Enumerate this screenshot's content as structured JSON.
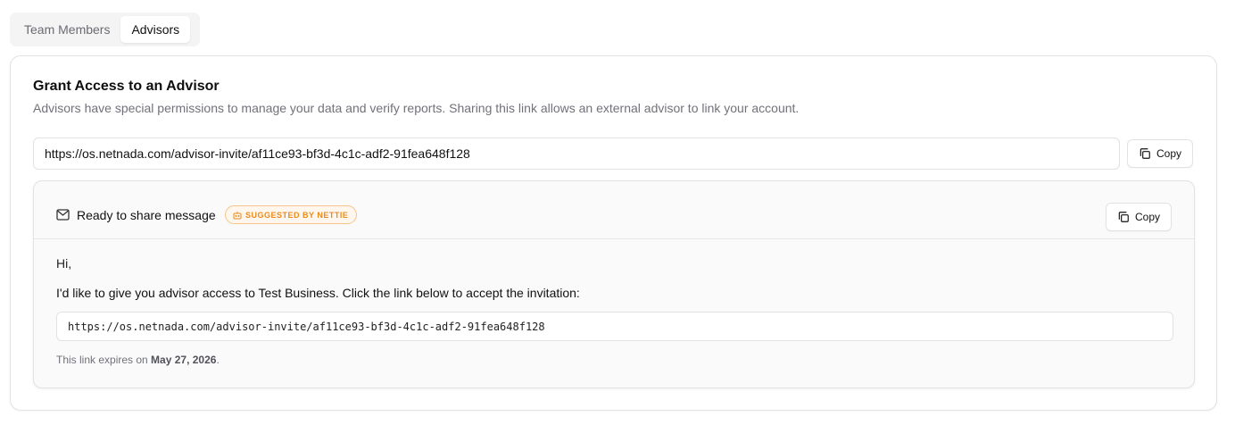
{
  "tabs": [
    {
      "label": "Team Members",
      "active": false
    },
    {
      "label": "Advisors",
      "active": true
    }
  ],
  "card": {
    "title": "Grant Access to an Advisor",
    "description": "Advisors have special permissions to manage your data and verify reports. Sharing this link allows an external advisor to link your account.",
    "invite_url": "https://os.netnada.com/advisor-invite/af11ce93-bf3d-4c1c-adf2-91fea648f128",
    "copy_label": "Copy"
  },
  "message": {
    "header_title": "Ready to share message",
    "badge": "SUGGESTED BY NETTIE",
    "copy_label": "Copy",
    "greeting": "Hi,",
    "body": "I'd like to give you advisor access to Test Business. Click the link below to accept the invitation:",
    "link": "https://os.netnada.com/advisor-invite/af11ce93-bf3d-4c1c-adf2-91fea648f128",
    "expiry_prefix": "This link expires on",
    "expiry_date": "May 27, 2026",
    "expiry_suffix": "."
  },
  "icons": {
    "copy": "copy-icon",
    "mail": "mail-icon",
    "bot": "bot-icon"
  },
  "colors": {
    "badge_text": "#ea8a1c",
    "badge_border": "#f5c38b",
    "badge_bg": "#fff7ed"
  }
}
